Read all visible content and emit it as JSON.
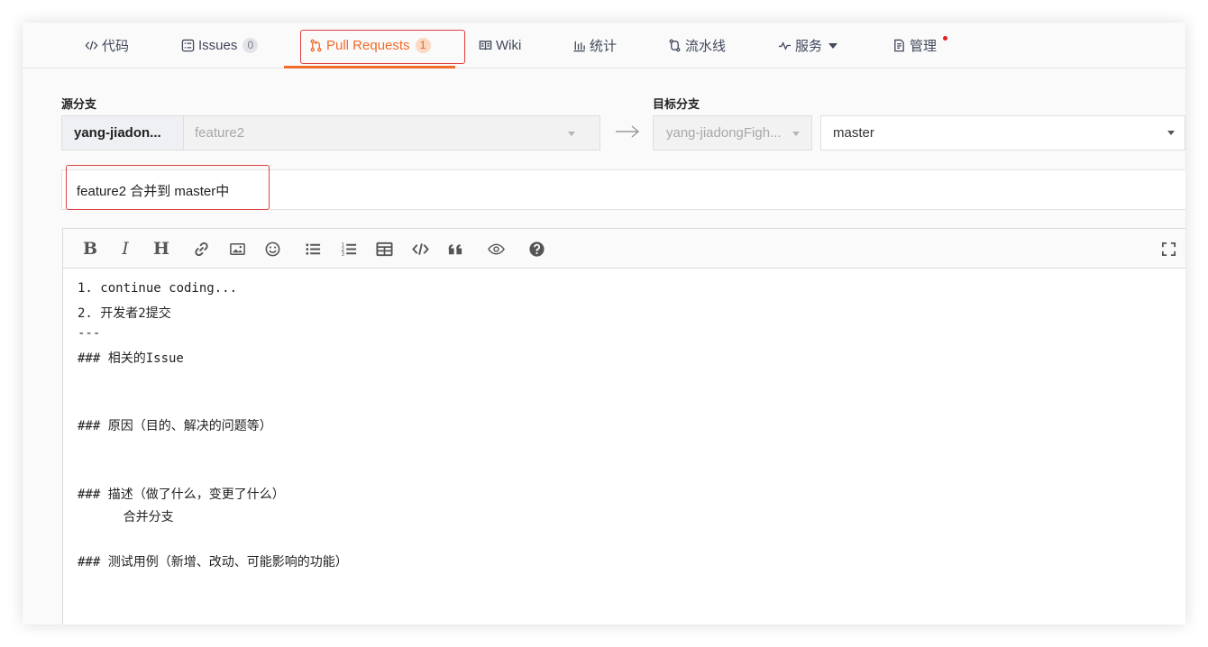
{
  "tabs": [
    {
      "label": "代码",
      "icon": "code-icon"
    },
    {
      "label": "Issues",
      "badge": "0",
      "icon": "issues-icon"
    },
    {
      "label": "Pull Requests",
      "badge": "1",
      "icon": "pull-request-icon",
      "active": true
    },
    {
      "label": "Wiki",
      "icon": "book-icon"
    },
    {
      "label": "统计",
      "icon": "bar-chart-icon"
    },
    {
      "label": "流水线",
      "icon": "pipeline-icon"
    },
    {
      "label": "服务",
      "icon": "pulse-icon"
    },
    {
      "label": "管理",
      "icon": "manage-icon"
    }
  ],
  "source_branch": {
    "label": "源分支",
    "owner": "yang-jiadon...",
    "branch": "feature2"
  },
  "target_branch": {
    "label": "目标分支",
    "repo": "yang-jiadongFigh...",
    "branch": "master"
  },
  "pr_title": "feature2 合并到 master中",
  "toolbar": [
    "bold",
    "italic",
    "heading",
    "link",
    "image",
    "emoji",
    "bullet-list",
    "ordered-list",
    "table",
    "code",
    "quote",
    "preview",
    "help",
    "fullscreen"
  ],
  "body_lines": [
    "1. continue coding...",
    "2. 开发者2提交",
    "---",
    "### 相关的Issue",
    "",
    "",
    "### 原因（目的、解决的问题等）",
    "",
    "",
    "### 描述（做了什么，变更了什么）",
    "      合并分支",
    "",
    "### 测试用例（新增、改动、可能影响的功能）"
  ],
  "colors": {
    "accent": "#f26b2a",
    "highlight": "#e0403f"
  }
}
